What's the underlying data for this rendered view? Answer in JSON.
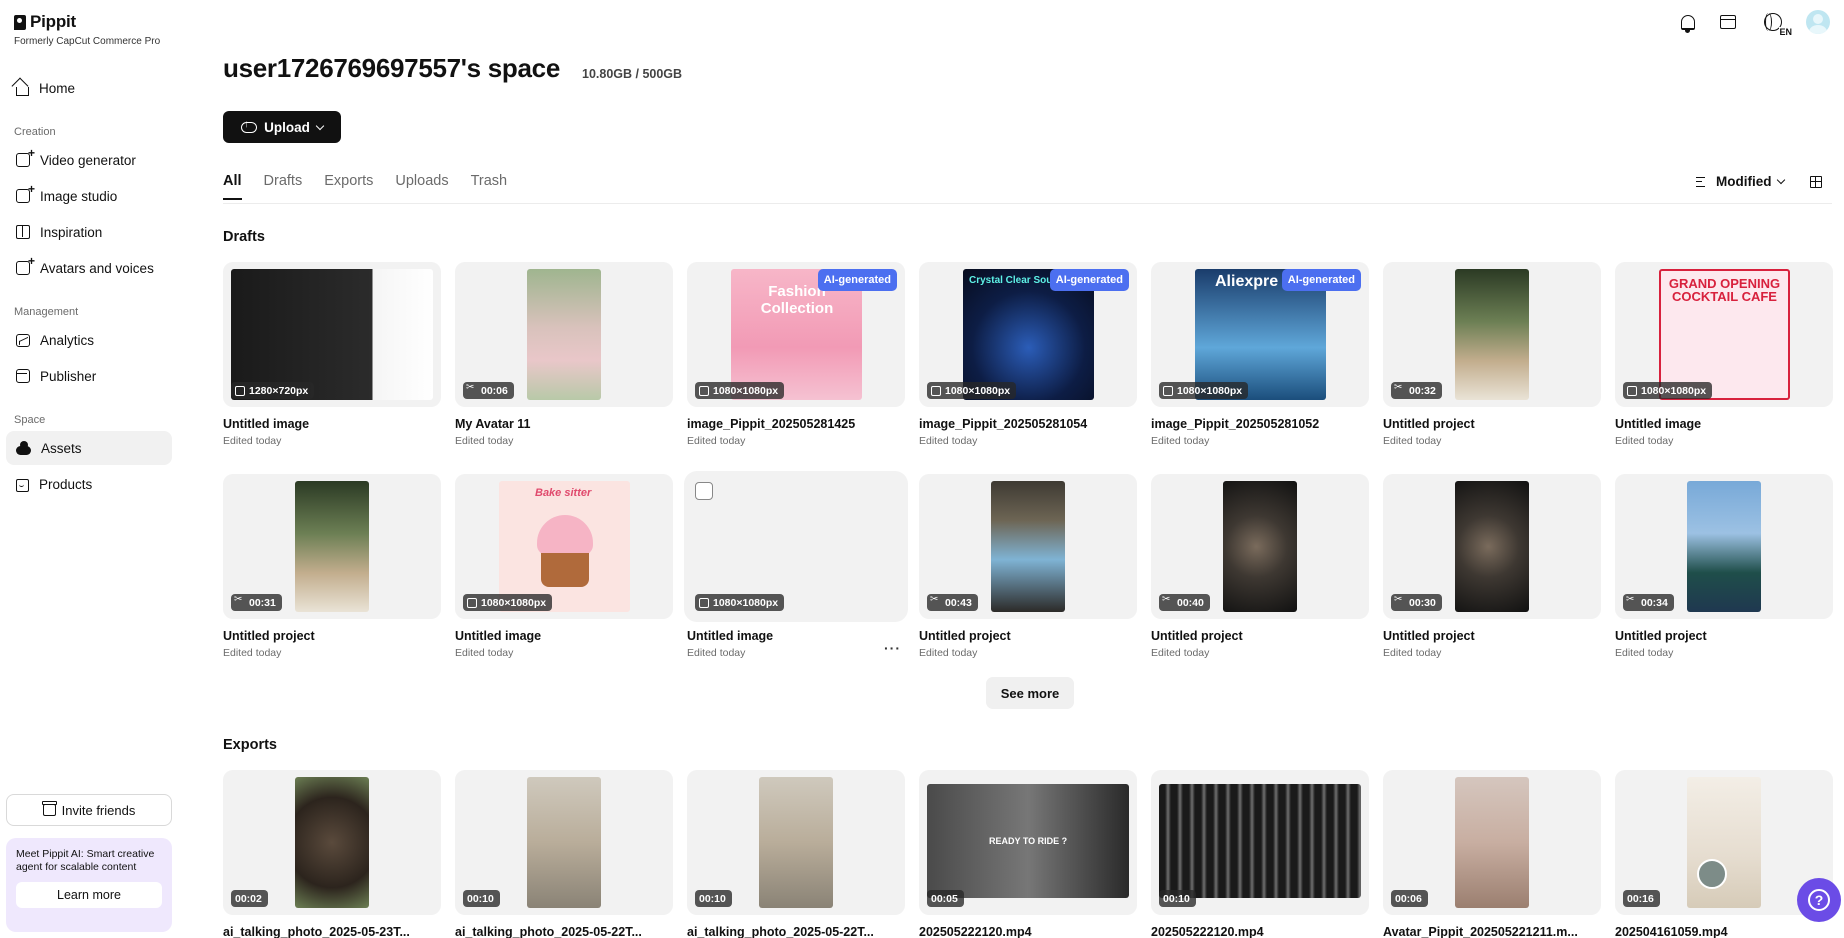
{
  "brand": {
    "name": "Pippit",
    "subtitle": "Formerly CapCut Commerce Pro"
  },
  "sidebar": {
    "home": "Home",
    "sections": {
      "creation": "Creation",
      "management": "Management",
      "space": "Space"
    },
    "creation_items": [
      "Video generator",
      "Image studio",
      "Inspiration",
      "Avatars and voices"
    ],
    "management_items": [
      "Analytics",
      "Publisher"
    ],
    "space_items": [
      "Assets",
      "Products"
    ],
    "invite": "Invite friends",
    "promo_text": "Meet Pippit AI: Smart creative agent for scalable content",
    "promo_button": "Learn more"
  },
  "header": {
    "language": "EN"
  },
  "space": {
    "title": "user1726769697557's space",
    "usage": "10.80GB / 500GB",
    "upload_label": "Upload"
  },
  "tabs": [
    "All",
    "Drafts",
    "Exports",
    "Uploads",
    "Trash"
  ],
  "sort_label": "Modified",
  "drafts": {
    "title": "Drafts",
    "items": [
      {
        "title": "Untitled image",
        "sub": "Edited today",
        "badge": "1280×720px",
        "ai": ""
      },
      {
        "title": "My Avatar 11",
        "sub": "Edited today",
        "badge": "00:06",
        "ai": ""
      },
      {
        "title": "image_Pippit_202505281425",
        "sub": "Edited today",
        "badge": "1080×1080px",
        "ai": "AI-generated",
        "overlay": "Fashion Collection"
      },
      {
        "title": "image_Pippit_202505281054",
        "sub": "Edited today",
        "badge": "1080×1080px",
        "ai": "AI-generated",
        "overlay": "Crystal Clear Sou"
      },
      {
        "title": "image_Pippit_202505281052",
        "sub": "Edited today",
        "badge": "1080×1080px",
        "ai": "AI-generated",
        "overlay": "Aliexpre"
      },
      {
        "title": "Untitled project",
        "sub": "Edited today",
        "badge": "00:32",
        "ai": ""
      },
      {
        "title": "Untitled image",
        "sub": "Edited today",
        "badge": "1080×1080px",
        "ai": "",
        "overlay": "GRAND OPENING COCKTAIL CAFE"
      },
      {
        "title": "Untitled project",
        "sub": "Edited today",
        "badge": "00:31",
        "ai": ""
      },
      {
        "title": "Untitled image",
        "sub": "Edited today",
        "badge": "1080×1080px",
        "ai": "",
        "overlay": "Bake sitter"
      },
      {
        "title": "Untitled image",
        "sub": "Edited today",
        "badge": "1080×1080px",
        "ai": ""
      },
      {
        "title": "Untitled project",
        "sub": "Edited today",
        "badge": "00:43",
        "ai": ""
      },
      {
        "title": "Untitled project",
        "sub": "Edited today",
        "badge": "00:40",
        "ai": ""
      },
      {
        "title": "Untitled project",
        "sub": "Edited today",
        "badge": "00:30",
        "ai": ""
      },
      {
        "title": "Untitled project",
        "sub": "Edited today",
        "badge": "00:34",
        "ai": ""
      }
    ],
    "see_more": "See more"
  },
  "exports": {
    "title": "Exports",
    "items": [
      {
        "title": "ai_talking_photo_2025-05-23T...",
        "badge": "00:02"
      },
      {
        "title": "ai_talking_photo_2025-05-22T...",
        "badge": "00:10"
      },
      {
        "title": "ai_talking_photo_2025-05-22T...",
        "badge": "00:10"
      },
      {
        "title": "202505222120.mp4",
        "badge": "00:05",
        "overlay": "READY TO RIDE ?"
      },
      {
        "title": "202505222120.mp4",
        "badge": "00:10"
      },
      {
        "title": "Avatar_Pippit_202505221211.m...",
        "badge": "00:06"
      },
      {
        "title": "202504161059.mp4",
        "badge": "00:16"
      }
    ]
  }
}
